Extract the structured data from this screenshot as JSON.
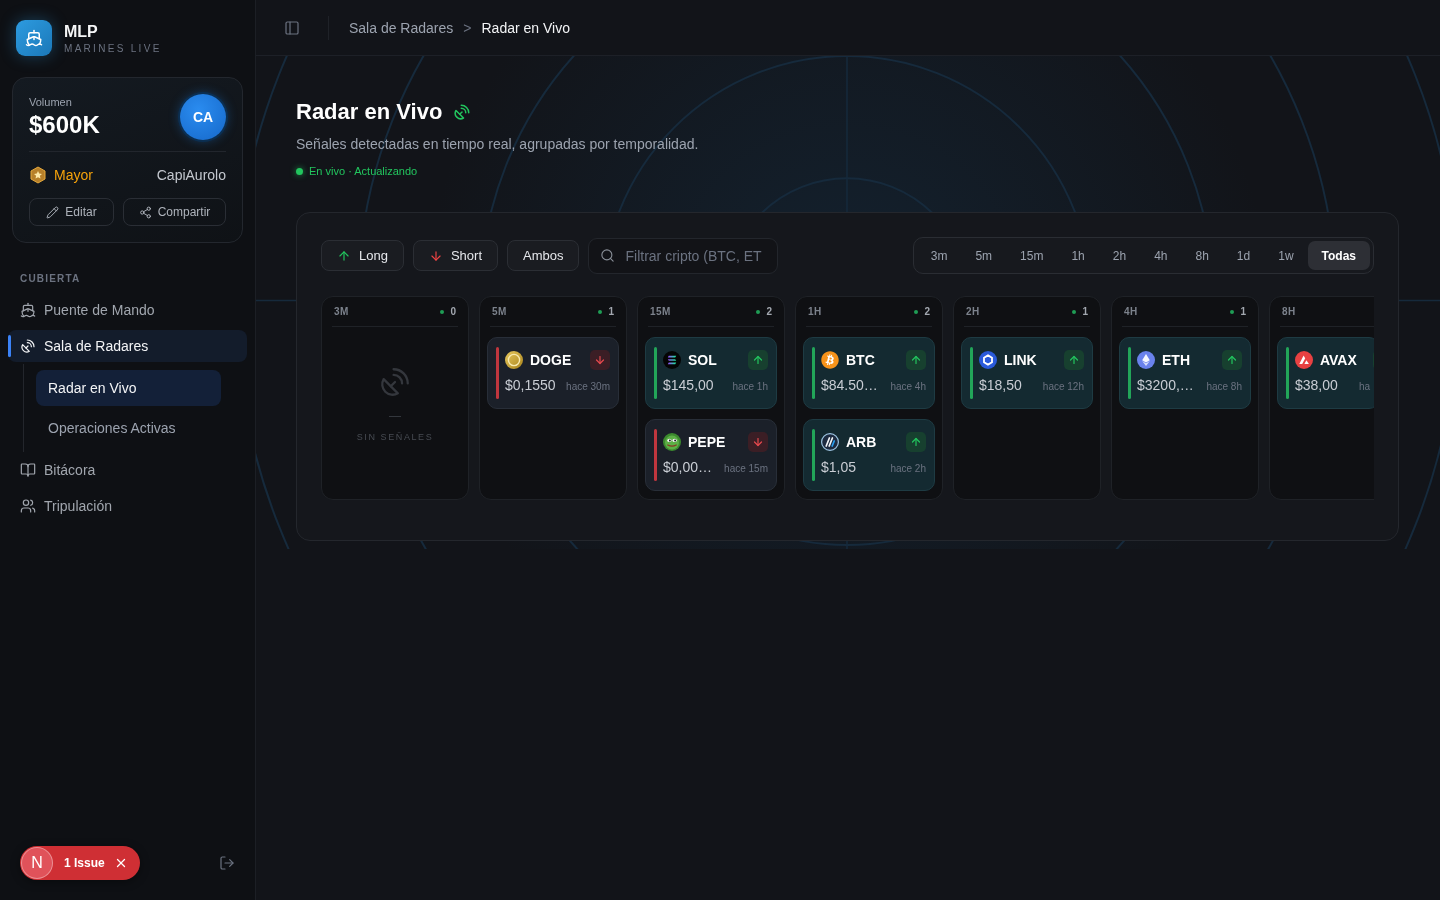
{
  "sidebar": {
    "brand": {
      "name": "MLP",
      "tagline": "MARINES LIVE"
    },
    "profile": {
      "label": "Volumen",
      "value": "$600K",
      "avatar": "CA",
      "rank": "Mayor",
      "username": "CapiAurolo",
      "buttons": [
        {
          "label": "Editar",
          "kind": "edit"
        },
        {
          "label": "Compartir",
          "kind": "share"
        }
      ]
    },
    "section_label": "CUBIERTA",
    "nav": [
      {
        "label": "Puente de Mando",
        "selected": false
      },
      {
        "label": "Sala de Radares",
        "selected": true,
        "children": [
          {
            "label": "Radar en Vivo",
            "selected": true
          },
          {
            "label": "Operaciones Activas",
            "selected": false
          }
        ]
      },
      {
        "label": "Bitácora",
        "selected": false
      },
      {
        "label": "Tripulación",
        "selected": false
      }
    ],
    "dev_badge": {
      "logo": "N",
      "label": "1 Issue"
    }
  },
  "header": {
    "breadcrumb": [
      {
        "label": "Sala de Radares",
        "selected": false
      },
      {
        "label": "Radar en Vivo",
        "selected": true
      }
    ],
    "separator": ">"
  },
  "page": {
    "title": "Radar en Vivo",
    "subtitle": "Señales detectadas en tiempo real, agrupadas por temporalidad.",
    "status": {
      "label": "En vivo · Actualizando",
      "live": true
    }
  },
  "filters": {
    "directions": [
      {
        "label": "Long",
        "kind": "long"
      },
      {
        "label": "Short",
        "kind": "short"
      },
      {
        "label": "Ambos",
        "kind": "both"
      }
    ],
    "search": {
      "placeholder": "Filtrar cripto (BTC, ET"
    },
    "timeframes": [
      {
        "label": "3m",
        "selected": false
      },
      {
        "label": "5m",
        "selected": false
      },
      {
        "label": "15m",
        "selected": false
      },
      {
        "label": "1h",
        "selected": false
      },
      {
        "label": "2h",
        "selected": false
      },
      {
        "label": "4h",
        "selected": false
      },
      {
        "label": "8h",
        "selected": false
      },
      {
        "label": "1d",
        "selected": false
      },
      {
        "label": "1w",
        "selected": false
      },
      {
        "label": "Todas",
        "selected": true
      }
    ]
  },
  "columns": [
    {
      "label": "3M",
      "count": "0",
      "empty": {
        "mark": "—",
        "label": "SIN SEÑALES"
      }
    },
    {
      "label": "5M",
      "count": "1",
      "signals": [
        {
          "symbol": "DOGE",
          "kind": "short",
          "price": "$0,1550",
          "age": "hace 30m"
        }
      ]
    },
    {
      "label": "15M",
      "count": "2",
      "signals": [
        {
          "symbol": "SOL",
          "kind": "long",
          "price": "$145,00",
          "age": "hace 1h"
        },
        {
          "symbol": "PEPE",
          "kind": "short",
          "price": "$0,00…",
          "age": "hace 15m"
        }
      ]
    },
    {
      "label": "1H",
      "count": "2",
      "signals": [
        {
          "symbol": "BTC",
          "kind": "long",
          "price": "$84.50…",
          "age": "hace 4h"
        },
        {
          "symbol": "ARB",
          "kind": "long",
          "price": "$1,05",
          "age": "hace 2h"
        }
      ]
    },
    {
      "label": "2H",
      "count": "1",
      "signals": [
        {
          "symbol": "LINK",
          "kind": "long",
          "price": "$18,50",
          "age": "hace 12h"
        }
      ]
    },
    {
      "label": "4H",
      "count": "1",
      "signals": [
        {
          "symbol": "ETH",
          "kind": "long",
          "price": "$3200,…",
          "age": "hace 8h"
        }
      ]
    },
    {
      "label": "8H",
      "signals": [
        {
          "symbol": "AVAX",
          "kind": "long",
          "price": "$38,00",
          "age": "ha"
        }
      ]
    }
  ]
}
